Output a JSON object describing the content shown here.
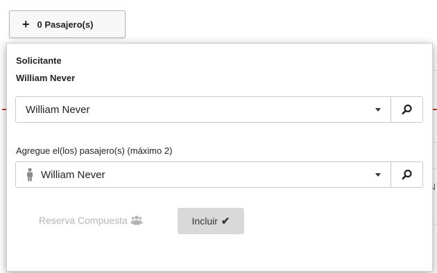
{
  "toggle": {
    "icon": "plus-icon",
    "label": "0 Pasajero(s)"
  },
  "panel": {
    "requester_heading": "Solicitante",
    "requester_name": "William Never",
    "requester_select": {
      "value": "William Never",
      "caret_icon": "caret-down-icon",
      "search_icon": "search-icon"
    },
    "passengers_label": "Agregue el(los) pasajero(s) (máximo 2)",
    "passenger_select": {
      "icon": "person-icon",
      "value": "William Never",
      "caret_icon": "caret-down-icon",
      "search_icon": "search-icon"
    },
    "composite_booking": {
      "label": "Reserva Compuesta",
      "icon": "group-icon",
      "color": "#b5b5b5"
    },
    "include_button": {
      "label": "Incluir",
      "icon": "check-icon",
      "background": "#d9d9d9"
    }
  },
  "background": {
    "partial_letter": "N",
    "accent_color": "#c0392b"
  }
}
